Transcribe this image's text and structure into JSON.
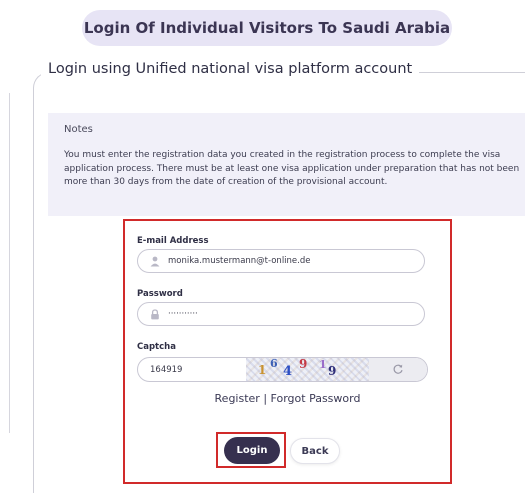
{
  "page_title": "Login Of Individual Visitors To Saudi Arabia",
  "section_legend": "Login using Unified national visa platform account",
  "notes": {
    "title": "Notes",
    "text": "You must enter the registration data you created in the registration process to complete the visa application process. There must be at least one visa application under preparation that has not been more than 30 days from the date of creation of the provisional account."
  },
  "form": {
    "email_label": "E-mail Address",
    "email_value": "monika.mustermann@t-online.de",
    "password_label": "Password",
    "password_value": "···········",
    "captcha_label": "Captcha",
    "captcha_value": "164919",
    "captcha_image_digits": [
      "1",
      "6",
      "4",
      "9",
      "1",
      "9"
    ],
    "register_link": "Register",
    "separator": "|",
    "forgot_link": "Forgot Password",
    "login_button": "Login",
    "back_button": "Back"
  },
  "icons": {
    "email_field": "user-icon",
    "password_field": "lock-icon",
    "captcha_refresh": "refresh-icon"
  },
  "colors": {
    "title_pill_bg": "#e7e4f5",
    "notes_bg": "#f1f0f9",
    "primary_button": "#36304f",
    "highlight_border": "#d12a2a"
  }
}
